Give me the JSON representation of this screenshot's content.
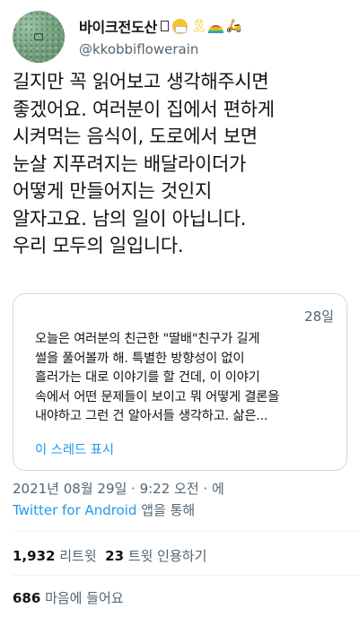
{
  "author": {
    "display_name": "바이크전도산",
    "handle": "@kkobbiflowerain"
  },
  "tweet": {
    "lines": [
      "길지만 꼭 읽어보고 생각해주시면",
      "좋겠어요. 여러분이 집에서 편하게",
      "시켜먹는 음식이, 도로에서 보면",
      "눈살 지푸려지는 배달라이더가",
      "어떻게 만들어지는 것인지",
      "알자고요. 남의 일이 아닙니다.",
      "우리 모두의 일입니다."
    ]
  },
  "quoted_tweet": {
    "date": "28일",
    "lines": [
      "오늘은 여러분의 친근한 \"딸배\"친구가 길게",
      "썰을 풀어볼까 해. 특별한 방향성이 없이",
      "흘러가는 대로 이야기를 할 건데, 이 이야기",
      "속에서 어떤 문제들이 보이고 뭐 어떻게 결론을",
      "내야하고 그런 건 알아서들 생각하고. 삶은..."
    ],
    "show_thread": "이 스레드 표시"
  },
  "meta": {
    "timestamp": "2021년 08월 29일 · 9:22 오전 · 에",
    "source_app": "Twitter for Android",
    "source_suffix": " 앱을 통해"
  },
  "stats": {
    "retweets_count": "1,932",
    "retweets_label": " 리트윗  ",
    "quotes_count": "23",
    "quotes_label": " 트윗 인용하기",
    "likes_count": "686",
    "likes_label": " 마음에 들어요"
  }
}
